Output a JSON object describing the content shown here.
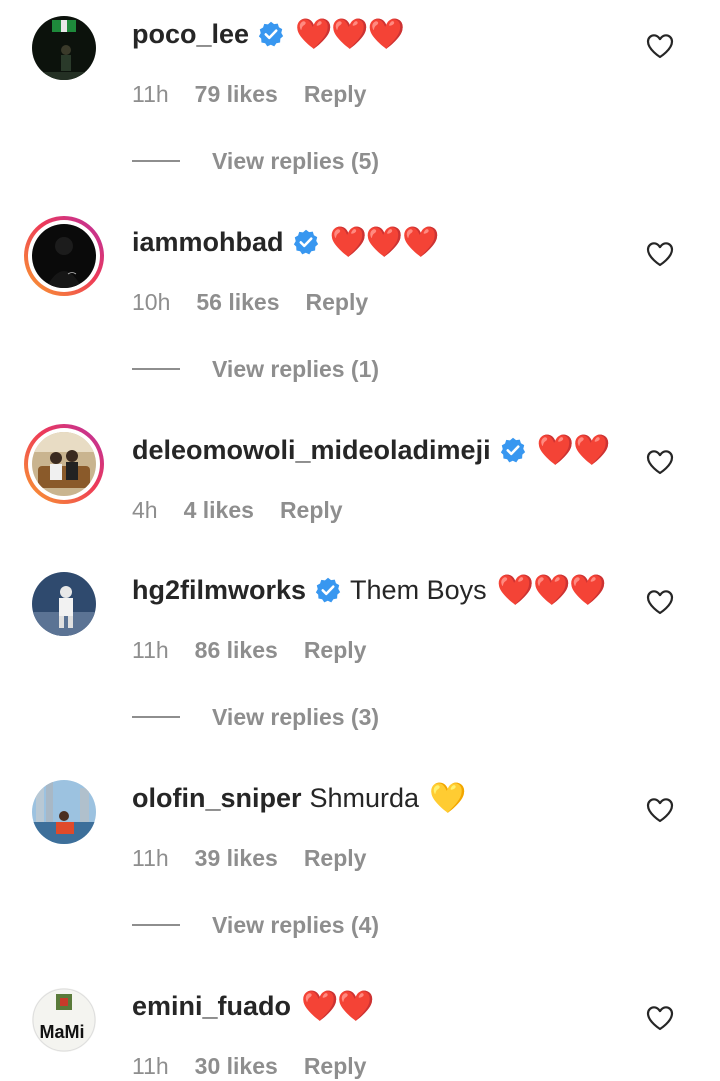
{
  "comments": [
    {
      "username": "poco_lee",
      "verified": true,
      "text": "",
      "emoji": "❤️❤️❤️",
      "time": "11h",
      "likes": "79 likes",
      "reply": "Reply",
      "view_replies": "View replies (5)",
      "story_ring": false
    },
    {
      "username": "iammohbad",
      "verified": true,
      "text": "",
      "emoji": "❤️❤️❤️",
      "time": "10h",
      "likes": "56 likes",
      "reply": "Reply",
      "view_replies": "View replies (1)",
      "story_ring": true
    },
    {
      "username": "deleomowoli_mideoladimeji",
      "verified": true,
      "text": "",
      "emoji": "❤️❤️",
      "time": "4h",
      "likes": "4 likes",
      "reply": "Reply",
      "view_replies": "",
      "story_ring": true
    },
    {
      "username": "hg2filmworks",
      "verified": true,
      "text": "Them Boys",
      "emoji": "❤️❤️❤️",
      "time": "11h",
      "likes": "86 likes",
      "reply": "Reply",
      "view_replies": "View replies (3)",
      "story_ring": false
    },
    {
      "username": "olofin_sniper",
      "verified": false,
      "text": "Shmurda",
      "emoji": "💛",
      "time": "11h",
      "likes": "39 likes",
      "reply": "Reply",
      "view_replies": "View replies (4)",
      "story_ring": false
    },
    {
      "username": "emini_fuado",
      "verified": false,
      "text": "",
      "emoji": "❤️❤️",
      "time": "11h",
      "likes": "30 likes",
      "reply": "Reply",
      "view_replies": "",
      "story_ring": false
    }
  ],
  "avatar_texts": {
    "emini_fuado": "MaMi"
  },
  "colors": {
    "username": "#262626",
    "meta": "#8e8e8e",
    "verified_badge": "#3897f0",
    "heart_emoji": "#e0201f",
    "yellow_heart": "#f5c518"
  },
  "icons": {
    "like": "heart-outline-icon",
    "verified": "verified-badge-icon"
  }
}
